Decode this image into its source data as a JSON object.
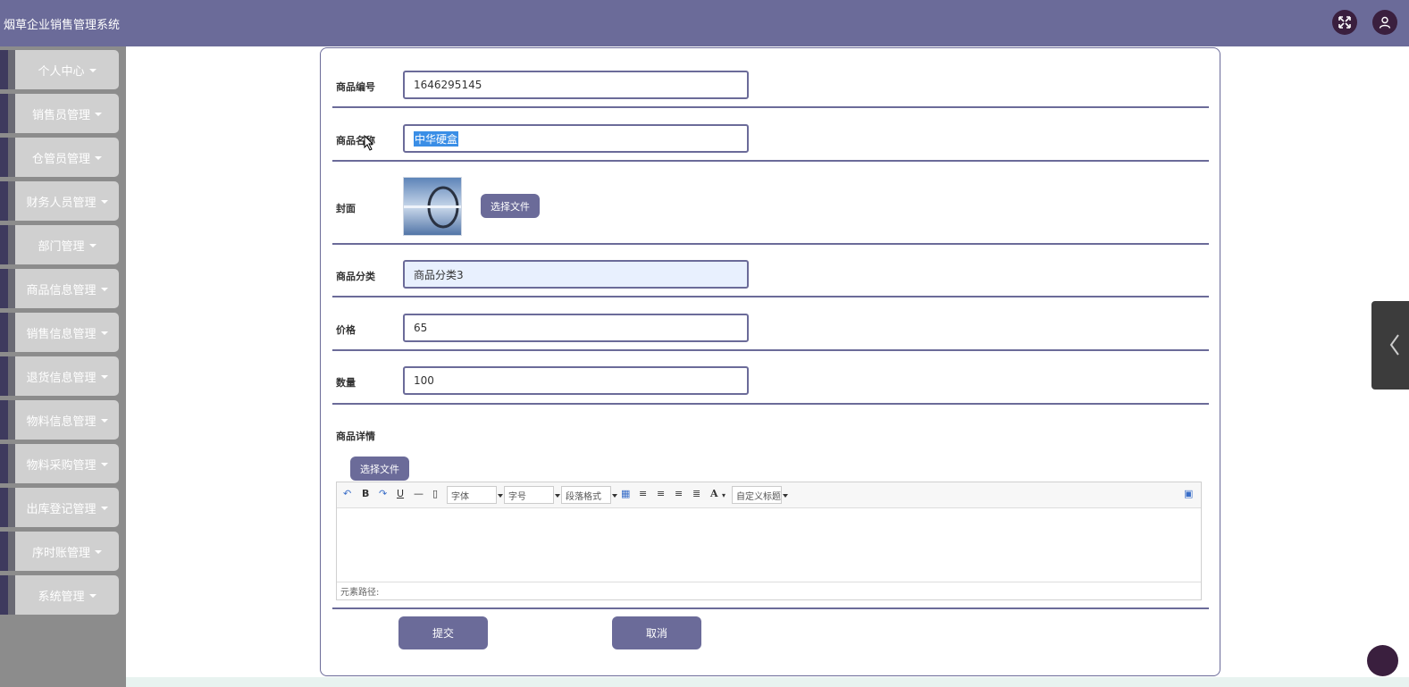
{
  "header": {
    "title": "烟草企业销售管理系统",
    "fullscreen_icon": "fullscreen-icon",
    "user_icon": "user-icon",
    "bg_color": "#6b6b99"
  },
  "sidebar": {
    "items": [
      {
        "label": "个人中心"
      },
      {
        "label": "销售员管理"
      },
      {
        "label": "仓管员管理"
      },
      {
        "label": "财务人员管理"
      },
      {
        "label": "部门管理"
      },
      {
        "label": "商品信息管理"
      },
      {
        "label": "销售信息管理"
      },
      {
        "label": "退货信息管理"
      },
      {
        "label": "物料信息管理"
      },
      {
        "label": "物料采购管理"
      },
      {
        "label": "出库登记管理"
      },
      {
        "label": "序时账管理"
      },
      {
        "label": "系统管理"
      }
    ]
  },
  "form": {
    "code": {
      "label": "商品编号",
      "value": "1646295145"
    },
    "name": {
      "label": "商品名称",
      "value": "中华硬盒"
    },
    "cover": {
      "label": "封面",
      "button": "选择文件"
    },
    "category": {
      "label": "商品分类",
      "value": "商品分类3"
    },
    "price": {
      "label": "价格",
      "value": "65"
    },
    "quantity": {
      "label": "数量",
      "value": "100"
    },
    "detail": {
      "label": "商品详情",
      "button": "选择文件"
    }
  },
  "editor": {
    "font_label": "字体",
    "size_label": "字号",
    "para_label": "段落格式",
    "custom_label": "自定义标题",
    "status": "元素路径:"
  },
  "actions": {
    "submit": "提交",
    "cancel": "取消"
  }
}
